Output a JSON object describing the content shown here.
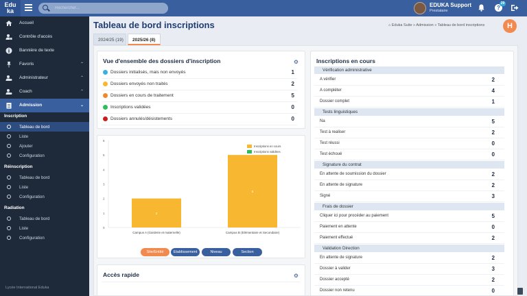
{
  "app": {
    "logo_line1": "Edu",
    "logo_line2": "ka",
    "search_placeholder": "Rechercher..."
  },
  "user": {
    "name": "EDUKA Support",
    "role": "Prestataire",
    "help_badge": "29"
  },
  "sidebar": {
    "items": [
      {
        "label": "Accueil",
        "icon": "home-icon"
      },
      {
        "label": "Contrôle d'accès",
        "icon": "user-lock-icon"
      },
      {
        "label": "Bannière de texte",
        "icon": "info-icon"
      },
      {
        "label": "Favoris",
        "icon": "pin-icon"
      },
      {
        "label": "Administrateur",
        "icon": "user-cog-icon"
      },
      {
        "label": "Coach",
        "icon": "user-cog-icon"
      },
      {
        "label": "Admission",
        "icon": "clipboard-icon"
      }
    ],
    "sections": [
      {
        "title": "Inscription",
        "items": [
          "Tableau de bord",
          "Liste",
          "Ajouter",
          "Configuration"
        ]
      },
      {
        "title": "Réinscription",
        "items": [
          "Tableau de bord",
          "Liste",
          "Configuration"
        ]
      },
      {
        "title": "Radiation",
        "items": [
          "Tableau de bord",
          "Liste",
          "Configuration"
        ]
      }
    ],
    "footer": "Lycée International Eduka"
  },
  "header": {
    "title": "Tableau de bord inscriptions",
    "breadcrumb": "Eduka Suite » Admission » Tableau de bord inscriptions",
    "badge": "H"
  },
  "tabs": [
    {
      "label": "2024/25 (19)",
      "active": false
    },
    {
      "label": "2025/26 (8)",
      "active": true
    }
  ],
  "overview": {
    "title": "Vue d'ensemble des dossiers d'inscription",
    "rows": [
      {
        "label": "Dossiers initialisés, mais non envoyés",
        "value": "1",
        "color": "#3ab0e0"
      },
      {
        "label": "Dossiers envoyés non traités",
        "value": "2",
        "color": "#f7b731"
      },
      {
        "label": "Dossiers en cours de traitement",
        "value": "5",
        "color": "#f0892e"
      },
      {
        "label": "Inscriptions validées",
        "value": "0",
        "color": "#2ebd59"
      },
      {
        "label": "Dossiers annulés/désistements",
        "value": "0",
        "color": "#c81e1e"
      }
    ]
  },
  "chart_data": {
    "type": "bar",
    "categories": [
      "Campus A (Garderie et maternelle)",
      "Campus B (Elémentaire et Secondaire)"
    ],
    "series": [
      {
        "name": "Inscriptions en cours",
        "values": [
          2,
          5
        ],
        "color": "#f7b731"
      },
      {
        "name": "Inscriptions validées",
        "values": [
          0,
          0
        ],
        "color": "#2ebd59"
      }
    ],
    "ylim": [
      0,
      6
    ],
    "yticks": [
      "0",
      "1",
      "2",
      "3",
      "4",
      "5",
      "6"
    ],
    "data_labels": [
      "2",
      "5"
    ],
    "legend": "top-right",
    "buttons": [
      {
        "label": "Site/Entité",
        "active": true
      },
      {
        "label": "Etablissement",
        "active": false
      },
      {
        "label": "Niveau",
        "active": false
      },
      {
        "label": "Section",
        "active": false
      }
    ]
  },
  "quick_access": {
    "title": "Accès rapide"
  },
  "inscriptions": {
    "title": "Inscriptions en cours",
    "groups": [
      {
        "title": "Vérification administrative",
        "rows": [
          {
            "label": "A vérifier",
            "value": "2"
          },
          {
            "label": "A compléter",
            "value": "4"
          },
          {
            "label": "Dossier complet",
            "value": "1"
          }
        ]
      },
      {
        "title": "Tests linguistiques",
        "rows": [
          {
            "label": "Na",
            "value": "5"
          },
          {
            "label": "Test à realiser",
            "value": "2"
          },
          {
            "label": "Test réussi",
            "value": "0"
          },
          {
            "label": "Test échoué",
            "value": "0"
          }
        ]
      },
      {
        "title": "Signature du contrat",
        "rows": [
          {
            "label": "En attente de soumission du dossier",
            "value": "2"
          },
          {
            "label": "En attente de signature",
            "value": "2"
          },
          {
            "label": "Signé",
            "value": "3"
          }
        ]
      },
      {
        "title": "Frais de dossier",
        "rows": [
          {
            "label": "Cliquer ici pour procéder au paiement",
            "value": "5"
          },
          {
            "label": "Paiement en attente",
            "value": "0"
          },
          {
            "label": "Paiement effectué",
            "value": "2"
          }
        ]
      },
      {
        "title": "Validation Direction",
        "rows": [
          {
            "label": "En attente de signature",
            "value": "2"
          },
          {
            "label": "Dossier à valider",
            "value": "3"
          },
          {
            "label": "Dossier accepté",
            "value": "2"
          },
          {
            "label": "Dossier non retenu",
            "value": "0"
          }
        ]
      }
    ]
  }
}
